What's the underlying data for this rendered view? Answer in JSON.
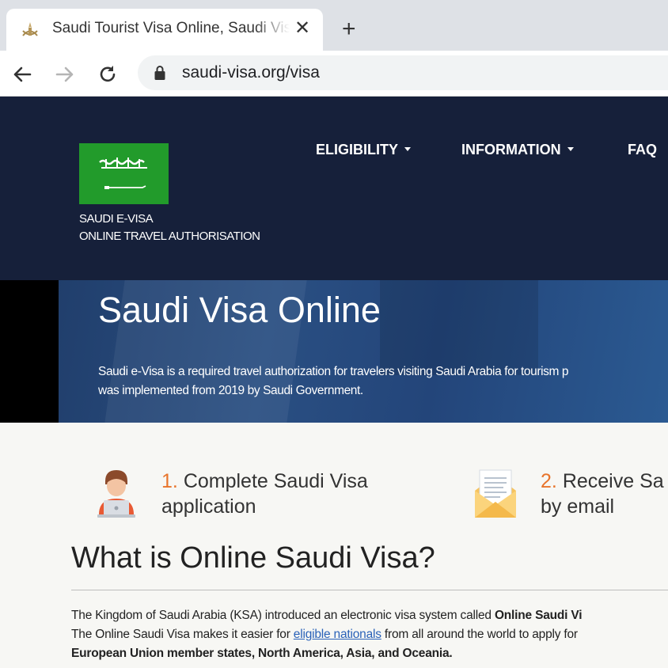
{
  "browser": {
    "tab_title": "Saudi Tourist Visa Online, Saudi Visa",
    "close_glyph": "✕",
    "new_tab_glyph": "+",
    "url": "saudi-visa.org/visa"
  },
  "header": {
    "brand_line1": "SAUDI E-VISA",
    "brand_line2": "ONLINE TRAVEL AUTHORISATION",
    "flag_color": "#229b2b",
    "bg_color": "#16203a",
    "nav": [
      "ELIGIBILITY",
      "INFORMATION",
      "FAQ"
    ]
  },
  "hero": {
    "title": "Saudi Visa Online",
    "desc_line1": "Saudi e-Visa is a required travel authorization for travelers visiting Saudi Arabia for tourism p",
    "desc_line2": "was implemented from 2019 by Saudi Government."
  },
  "steps": [
    {
      "num": "1.",
      "line1": "Complete Saudi Visa",
      "line2": "application",
      "icon": "person-laptop-icon"
    },
    {
      "num": "2.",
      "line1": "Receive Sa",
      "line2": "by email",
      "icon": "envelope-icon"
    }
  ],
  "content": {
    "title": "What is Online Saudi Visa?",
    "p1_text": "The Kingdom of Saudi Arabia (KSA) introduced an electronic visa system called ",
    "p1_bold": "Online Saudi Vi",
    "p2_before": "The Online Saudi Visa makes it easier for ",
    "p2_link": "eligible nationals",
    "p2_after": " from all around the world to apply for",
    "p3_bold": "European Union member states, North America, Asia, and Oceania."
  },
  "accent_color": "#e8742b"
}
